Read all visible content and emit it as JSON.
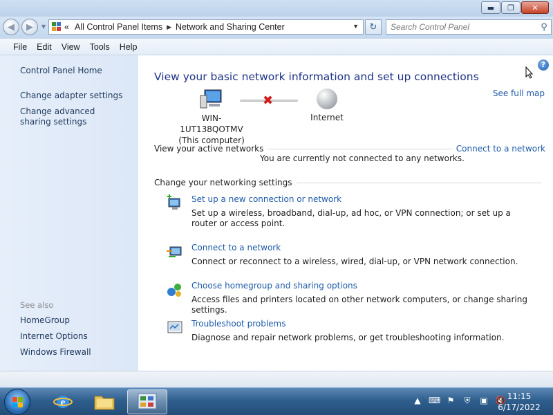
{
  "window": {
    "buttons": {
      "minimize": "▬",
      "maximize": "❐",
      "close": "✕"
    }
  },
  "nav": {
    "back": "◀",
    "forward": "▶",
    "breadcrumb": [
      "All Control Panel Items",
      "Network and Sharing Center"
    ],
    "breadcrumb_prefix": "«",
    "refresh": "↻",
    "search_placeholder": "Search Control Panel"
  },
  "menu": [
    "File",
    "Edit",
    "View",
    "Tools",
    "Help"
  ],
  "sidebar": {
    "home": "Control Panel Home",
    "links": [
      "Change adapter settings",
      "Change advanced sharing settings"
    ],
    "see_also_label": "See also",
    "see_also": [
      "HomeGroup",
      "Internet Options",
      "Windows Firewall"
    ]
  },
  "main": {
    "heading": "View your basic network information and set up connections",
    "see_full_map": "See full map",
    "computer_name": "WIN-1UT138QOTMV",
    "computer_sub": "(This computer)",
    "internet_label": "Internet",
    "active_networks_label": "View your active networks",
    "connect_link": "Connect to a network",
    "not_connected": "You are currently not connected to any networks.",
    "change_settings_label": "Change your networking settings",
    "tasks": [
      {
        "title": "Set up a new connection or network",
        "desc": "Set up a wireless, broadband, dial-up, ad hoc, or VPN connection; or set up a router or access point.",
        "icon": "setup-connection-icon"
      },
      {
        "title": "Connect to a network",
        "desc": "Connect or reconnect to a wireless, wired, dial-up, or VPN network connection.",
        "icon": "connect-network-icon"
      },
      {
        "title": "Choose homegroup and sharing options",
        "desc": "Access files and printers located on other network computers, or change sharing settings.",
        "icon": "homegroup-icon"
      },
      {
        "title": "Troubleshoot problems",
        "desc": "Diagnose and repair network problems, or get troubleshooting information.",
        "icon": "troubleshoot-icon"
      }
    ],
    "help": "?"
  },
  "taskbar": {
    "time": "11:15",
    "date": "6/17/2022"
  },
  "colors": {
    "link": "#1c5aa8",
    "heading": "#1e3287",
    "error_x": "#d41a1a"
  }
}
